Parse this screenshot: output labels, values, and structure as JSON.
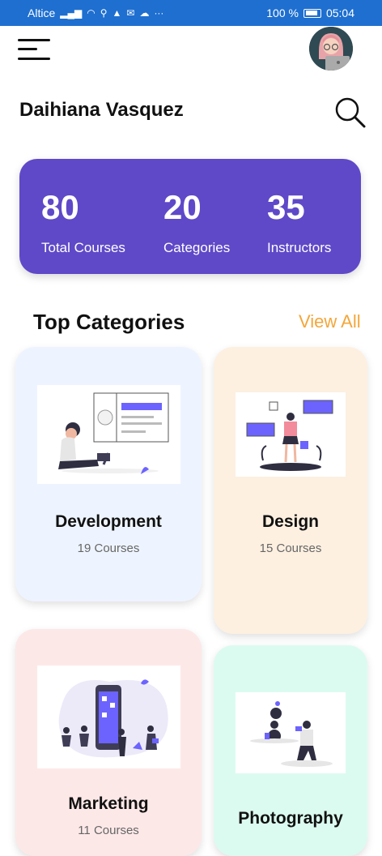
{
  "status_bar": {
    "carrier": "Altice",
    "battery_percent": "100 %",
    "time": "05:04"
  },
  "header": {
    "user_name": "Daihiana Vasquez"
  },
  "stats": [
    {
      "value": "80",
      "label": "Total Courses"
    },
    {
      "value": "20",
      "label": "Categories"
    },
    {
      "value": "35",
      "label": "Instructors"
    }
  ],
  "section": {
    "title": "Top Categories",
    "view_all": "View All"
  },
  "categories": [
    {
      "name": "Development",
      "count": "19 Courses"
    },
    {
      "name": "Design",
      "count": "15 Courses"
    },
    {
      "name": "Marketing",
      "count": "11 Courses"
    },
    {
      "name": "Photography",
      "count": ""
    }
  ],
  "colors": {
    "status_bar": "#1e6fd0",
    "stats_card": "#5f49c8",
    "accent_orange": "#f3a63a",
    "illustration_purple": "#6c63ff"
  }
}
